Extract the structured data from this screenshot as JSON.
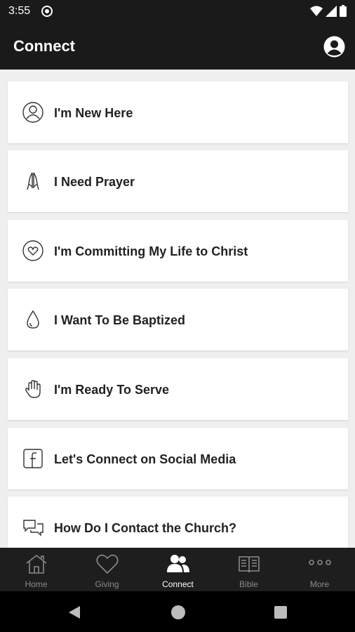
{
  "status": {
    "time": "3:55"
  },
  "header": {
    "title": "Connect"
  },
  "items": [
    {
      "label": "I'm New Here",
      "icon": "person-outline-icon"
    },
    {
      "label": "I Need Prayer",
      "icon": "praying-hands-icon"
    },
    {
      "label": "I'm Committing My Life to Christ",
      "icon": "heart-circle-icon"
    },
    {
      "label": "I Want To Be Baptized",
      "icon": "water-drop-icon"
    },
    {
      "label": "I'm Ready To Serve",
      "icon": "raised-hand-icon"
    },
    {
      "label": "Let's Connect on Social Media",
      "icon": "facebook-icon"
    },
    {
      "label": "How Do I Contact the Church?",
      "icon": "chat-bubbles-icon"
    }
  ],
  "tabs": [
    {
      "label": "Home",
      "icon": "house-icon"
    },
    {
      "label": "Giving",
      "icon": "heart-icon"
    },
    {
      "label": "Connect",
      "icon": "people-icon"
    },
    {
      "label": "Bible",
      "icon": "book-icon"
    },
    {
      "label": "More",
      "icon": "more-dots-icon"
    }
  ],
  "colors": {
    "bar": "#1a1a1a",
    "tabbar": "#1e1e1e",
    "active": "#ffffff",
    "inactive": "#8a8a8a",
    "background": "#efefef"
  }
}
